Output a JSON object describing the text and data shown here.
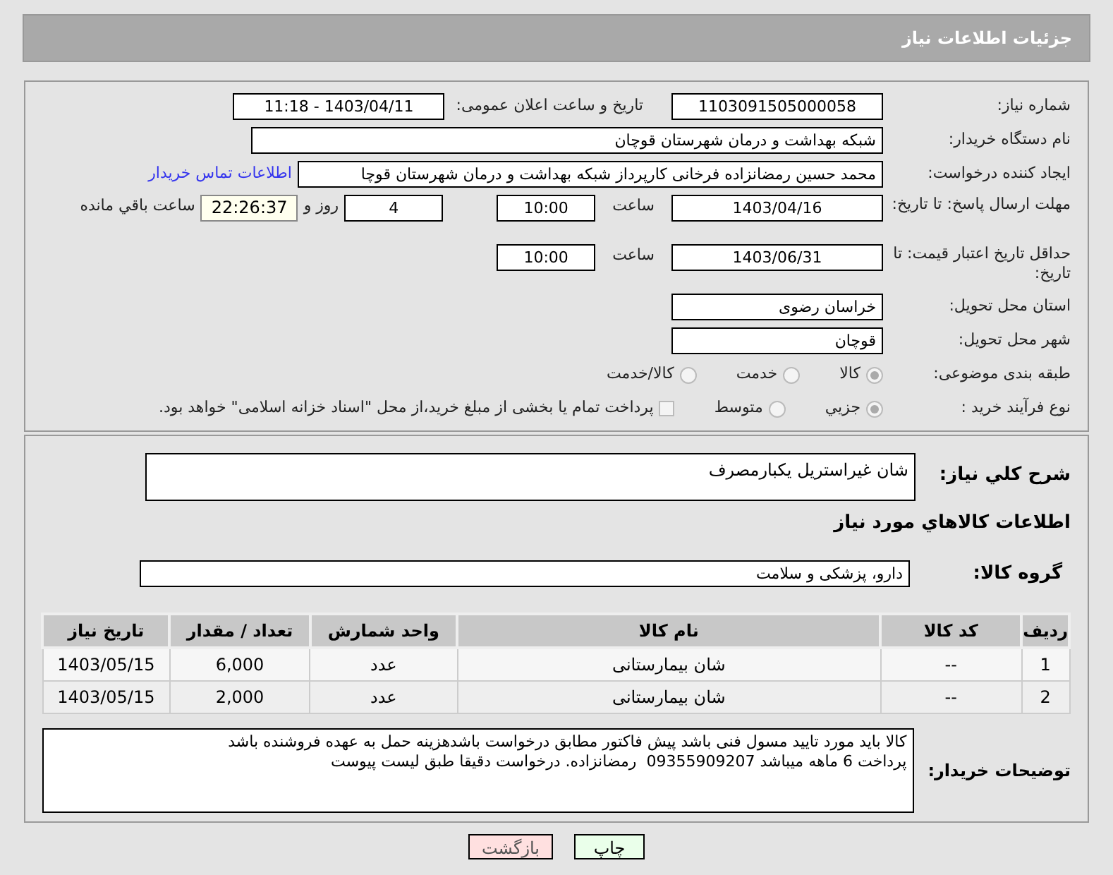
{
  "title": "جزئیات اطلاعات نیاز",
  "fields": {
    "need_number": {
      "label": "شماره نیاز:",
      "value": "1103091505000058"
    },
    "announce": {
      "label": "تاریخ و ساعت اعلان عمومی:",
      "value": "1403/04/11 - 11:18"
    },
    "buyer": {
      "label": "نام دستگاه خریدار:",
      "value": "شبکه بهداشت و درمان شهرستان قوچان"
    },
    "creator": {
      "label": "ایجاد کننده درخواست:",
      "value": "محمد حسین رمضانزاده فرخانی کارپرداز شبکه بهداشت و درمان شهرستان قوچا",
      "link": "اطلاعات تماس خریدار"
    },
    "deadline": {
      "label": "مهلت ارسال پاسخ: تا تاریخ:",
      "date": "1403/04/16",
      "time_label": "ساعت",
      "time": "10:00",
      "days": "4",
      "days_label": "روز و",
      "remaining": "22:26:37",
      "remaining_label": "ساعت باقي مانده"
    },
    "validity": {
      "label": "حداقل تاریخ اعتبار قیمت: تا تاریخ:",
      "date": "1403/06/31",
      "time_label": "ساعت",
      "time": "10:00"
    },
    "province": {
      "label": "استان محل تحویل:",
      "value": "خراسان رضوی"
    },
    "city": {
      "label": "شهر محل تحویل:",
      "value": "قوچان"
    }
  },
  "category": {
    "label": "طبقه بندی موضوعی:",
    "options": [
      {
        "label": "کالا",
        "selected": true
      },
      {
        "label": "خدمت",
        "selected": false
      },
      {
        "label": "کالا/خدمت",
        "selected": false
      }
    ]
  },
  "purchase_type": {
    "label": "نوع فرآیند خرید :",
    "options": [
      {
        "label": "جزیي",
        "selected": true
      },
      {
        "label": "متوسط",
        "selected": false
      }
    ],
    "payment": {
      "label": "پرداخت تمام یا بخشی از مبلغ خرید،از محل \"اسناد خزانه اسلامی\" خواهد بود.",
      "checked": false
    }
  },
  "description": {
    "label": "شرح کلي نياز:",
    "value": "شان غیراستریل یکبارمصرف"
  },
  "goods_title": "اطلاعات کالاهاي مورد نياز",
  "goods_group": {
    "label": "گروه کالا:",
    "value": "دارو، پزشکی و سلامت"
  },
  "table": {
    "columns": [
      "رديف",
      "کد کالا",
      "نام کالا",
      "واحد شمارش",
      "تعداد / مقدار",
      "تاریخ نیاز"
    ],
    "rows": [
      [
        "1",
        "--",
        "شان بیمارستانی",
        "عدد",
        "6,000",
        "1403/05/15"
      ],
      [
        "2",
        "--",
        "شان بیمارستانی",
        "عدد",
        "2,000",
        "1403/05/15"
      ]
    ]
  },
  "notes": {
    "label": "توضیحات خریدار:",
    "lines": [
      "کالا باید مورد تایید مسول فنی باشد پیش فاکتور مطابق درخواست باشدهزینه حمل به عهده فروشنده باشد",
      "پرداخت 6 ماهه میباشد 09355909207  رمضانزاده. درخواست دقیقا طبق لیست پیوست"
    ]
  },
  "buttons": [
    {
      "label": "چاپ",
      "kind": "print"
    },
    {
      "label": "بازگشت",
      "kind": "back"
    }
  ]
}
